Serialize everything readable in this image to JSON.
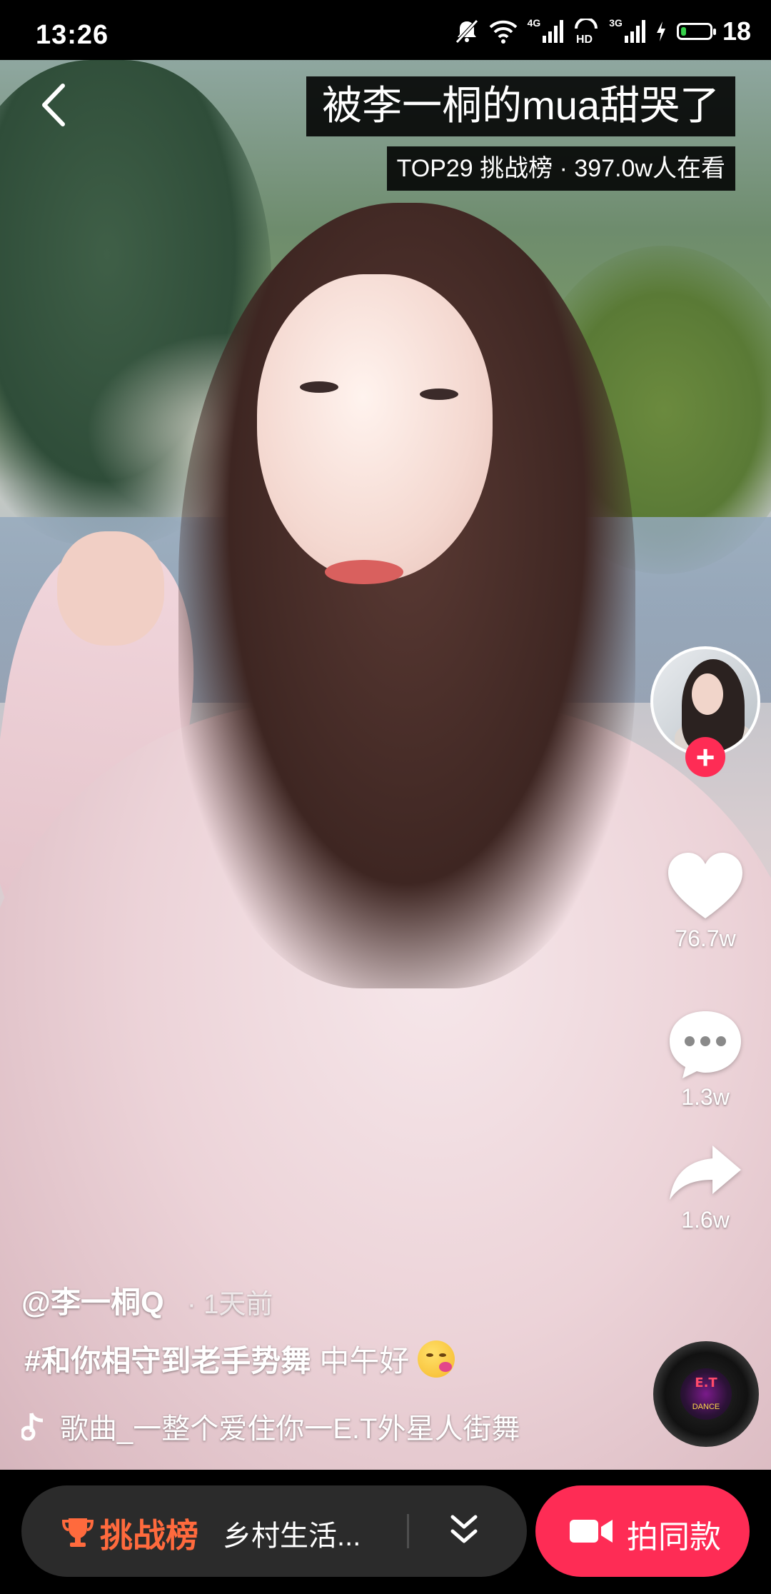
{
  "status_bar": {
    "time": "13:26",
    "network_1": "4G",
    "network_2": "3G",
    "battery": "18",
    "battery_level": 0.18
  },
  "header": {
    "title": "被李一桐的mua甜哭了",
    "rank_text": "TOP29 挑战榜 · 397.0w人在看"
  },
  "actions": {
    "likes": "76.7w",
    "comments": "1.3w",
    "shares": "1.6w"
  },
  "caption": {
    "author": "@李一桐Q",
    "time_ago": "· 1天前",
    "hashtag": "#和你相守到老手势舞",
    "text": "中午好"
  },
  "music": {
    "label": "歌曲_一整个爱住你一E.T外星人街舞",
    "disc_text_1": "E.T",
    "disc_text_2": "DANCE"
  },
  "bottom_bar": {
    "challenge_label": "挑战榜",
    "challenge_text": "乡村生活...",
    "shoot_label": "拍同款"
  },
  "colors": {
    "accent": "#fe2c55",
    "challenge_orange": "#ff6a3d",
    "battery_green": "#36d04a"
  },
  "icons": [
    "back-icon",
    "mute-icon",
    "wifi-icon",
    "signal-icon",
    "hd-icon",
    "charging-icon",
    "battery-icon",
    "plus-icon",
    "heart-icon",
    "comment-icon",
    "share-icon",
    "music-note-icon",
    "music-disc-icon",
    "trophy-icon",
    "chevron-double-down-icon",
    "video-camera-icon"
  ]
}
